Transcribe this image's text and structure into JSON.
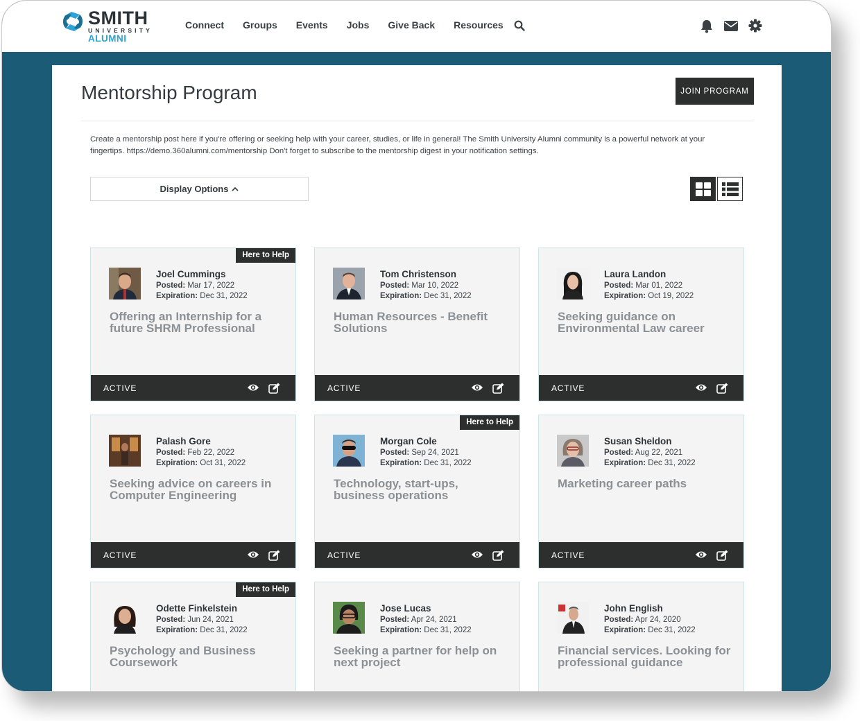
{
  "brand": {
    "name": "SMITH",
    "sub": "UNIVERSITY",
    "tag": "ALUMNI",
    "colors": {
      "accent": "#2ea3d6",
      "dark": "#2d2f2f",
      "frame": "#1b5b76"
    }
  },
  "nav": {
    "items": [
      "Connect",
      "Groups",
      "Events",
      "Jobs",
      "Give Back",
      "Resources"
    ],
    "search_icon": "search-icon",
    "right_icons": [
      "bell-icon",
      "envelope-icon",
      "gear-icon"
    ]
  },
  "page": {
    "title": "Mentorship Program",
    "join_label": "JOIN PROGRAM",
    "intro": "Create a mentorship post here if you're offering or seeking help with your career, studies, or life in general! The Smith University Alumni community is a powerful network at your fingertips. https://demo.360alumni.com/mentorship Don't forget to subscribe to the mentorship digest in your notification settings.",
    "display_options_label": "Display Options",
    "posted_label": "Posted:",
    "expiration_label": "Expiration:",
    "view_modes": [
      "grid-view-icon",
      "list-view-icon"
    ]
  },
  "cards": [
    {
      "name": "Joel Cummings",
      "posted": "Mar 17, 2022",
      "expiration": "Dec 31, 2022",
      "title": "Offering an Internship for a future SHRM Professional",
      "badge": "Here to Help",
      "status": "ACTIVE"
    },
    {
      "name": "Tom Christenson",
      "posted": "Mar 10, 2022",
      "expiration": "Dec 31, 2022",
      "title": "Human Resources - Benefit Solutions",
      "badge": "",
      "status": "ACTIVE"
    },
    {
      "name": "Laura Landon",
      "posted": "Mar 01, 2022",
      "expiration": "Oct 19, 2022",
      "title": "Seeking guidance on Environmental Law career",
      "badge": "",
      "status": "ACTIVE"
    },
    {
      "name": "Palash Gore",
      "posted": "Feb 22, 2022",
      "expiration": "Oct 31, 2022",
      "title": "Seeking advice on careers in Computer Engineering",
      "badge": "",
      "status": "ACTIVE"
    },
    {
      "name": "Morgan Cole",
      "posted": "Sep 24, 2021",
      "expiration": "Dec 31, 2022",
      "title": "Technology, start-ups, business operations",
      "badge": "Here to Help",
      "status": "ACTIVE"
    },
    {
      "name": "Susan Sheldon",
      "posted": "Aug 22, 2021",
      "expiration": "Dec 31, 2022",
      "title": "Marketing career paths",
      "badge": "",
      "status": "ACTIVE"
    },
    {
      "name": "Odette Finkelstein",
      "posted": "Jun 24, 2021",
      "expiration": "Dec 31, 2022",
      "title": "Psychology and Business Coursework",
      "badge": "Here to Help",
      "status": ""
    },
    {
      "name": "Jose Lucas",
      "posted": "Apr 24, 2021",
      "expiration": "Dec 31, 2022",
      "title": "Seeking a partner for help on next project",
      "badge": "",
      "status": ""
    },
    {
      "name": "John English",
      "posted": "Apr 24, 2020",
      "expiration": "Dec 31, 2022",
      "title": "Financial services. Looking for professional guidance",
      "badge": "",
      "status": ""
    }
  ]
}
